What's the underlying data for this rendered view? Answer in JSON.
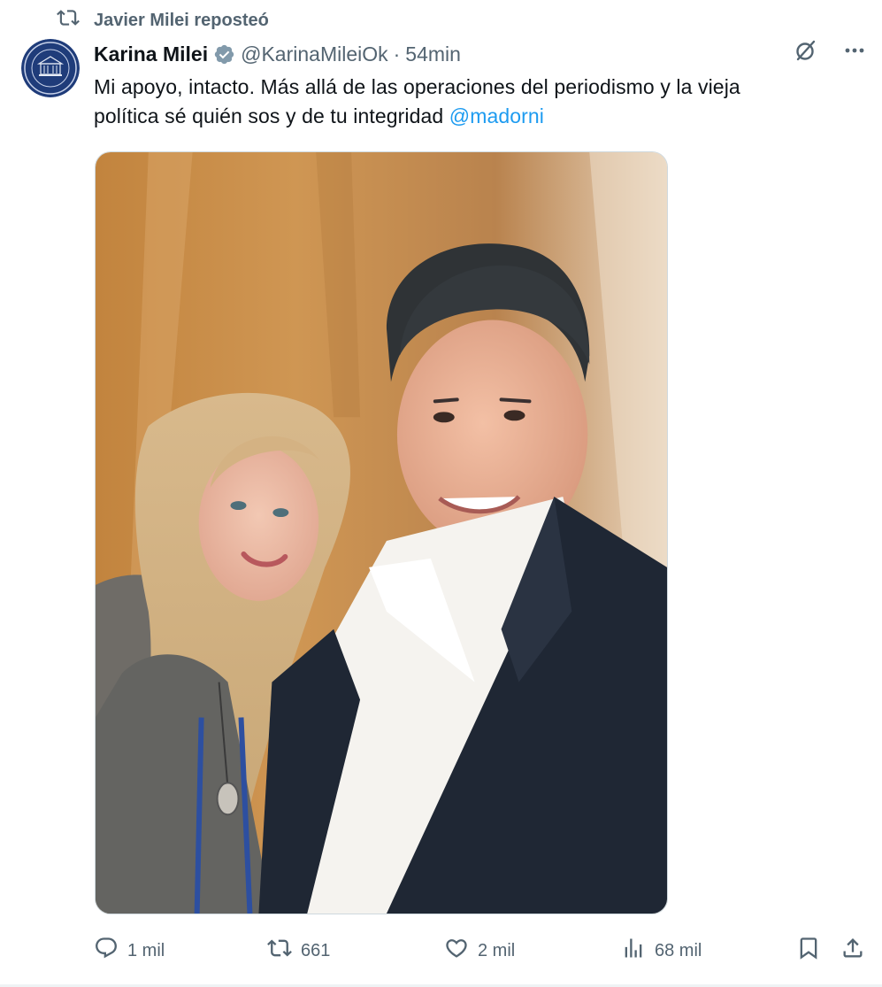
{
  "repost": {
    "icon": "repost-icon",
    "text": "Javier Milei reposteó"
  },
  "author": {
    "name": "Karina Milei",
    "verified_icon": "verified-badge-icon",
    "handle": "@KarinaMileiOk",
    "separator": "·",
    "time": "54min"
  },
  "tweet": {
    "text_line1": "Mi apoyo, intacto. Más allá de las operaciones del periodismo y la vieja",
    "text_line2": "política sé quién sos y de tu integridad ",
    "mention": "@madorni"
  },
  "actions": {
    "reply_count": "1 mil",
    "repost_count": "661",
    "like_count": "2 mil",
    "views_count": "68 mil"
  },
  "colors": {
    "accent": "#1d9bf0",
    "muted": "#536471",
    "text": "#0f1419"
  }
}
